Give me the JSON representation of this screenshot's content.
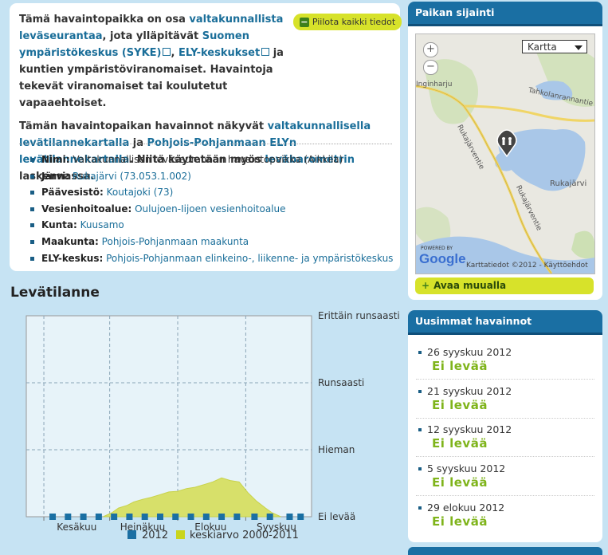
{
  "info": {
    "hide_all_label": "Piilota kaikki tiedot",
    "p1": {
      "t1": "Tämä havaintopaikka on osa ",
      "l1": "valtakunnallista leväseurantaa",
      "t2": ", jota ylläpitävät ",
      "l2": "Suomen ympäristökeskus (SYKE)",
      "t3": ", ",
      "l3": "ELY-keskukset",
      "t4": " ja kuntien ympäristöviranomaiset. Havaintoja tekevät viranomaiset tai koulutetut vapaaehtoiset."
    },
    "p2": {
      "t1": "Tämän havaintopaikan havainnot näkyvät ",
      "l1": "valtakunnallisella levätilannekartalla",
      "t2": " ja ",
      "l2": "Pohjois-Pohjanmaan ELYn levätilannekartalla",
      "t3": ". Niitä käytetään myös ",
      "l3": "leväbarometrin",
      "t4": " laskennassa."
    },
    "attributes": [
      {
        "label": "Nimi:",
        "value": "Valtakunnallisen leväseurannan havaintopaikka (Aikkila)",
        "link": false
      },
      {
        "label": "Järvi:",
        "value": "Rukajärvi (73.053.1.002)",
        "link": true
      },
      {
        "label": "Päävesistö:",
        "value": "Koutajoki (73)",
        "link": true
      },
      {
        "label": "Vesienhoitoalue:",
        "value": "Oulujoen-Iijoen vesienhoitoalue",
        "link": true
      },
      {
        "label": "Kunta:",
        "value": "Kuusamo",
        "link": true
      },
      {
        "label": "Maakunta:",
        "value": "Pohjois-Pohjanmaan maakunta",
        "link": true
      },
      {
        "label": "ELY-keskus:",
        "value": "Pohjois-Pohjanmaan elinkeino-, liikenne- ja ympäristökeskus",
        "link": true
      }
    ]
  },
  "chart_title": "Levätilanne",
  "chart_data": {
    "type": "area",
    "y_categories": [
      "Ei levää",
      "Hieman",
      "Runsaasti",
      "Erittäin runsaasti"
    ],
    "ylim": [
      0,
      3
    ],
    "x_tick_labels": [
      "Kesäkuu",
      "Heinäkuu",
      "Elokuu",
      "Syyskuu"
    ],
    "grid": true,
    "legend_position": "bottom",
    "series": [
      {
        "name": "2012",
        "kind": "markers",
        "color": "#1a6fa3",
        "x": [
          "2012-06-05",
          "2012-06-12",
          "2012-06-19",
          "2012-06-26",
          "2012-07-03",
          "2012-07-10",
          "2012-07-17",
          "2012-07-24",
          "2012-07-31",
          "2012-08-07",
          "2012-08-14",
          "2012-08-21",
          "2012-08-28",
          "2012-09-05",
          "2012-09-12",
          "2012-09-21",
          "2012-09-26"
        ],
        "values": [
          0,
          0,
          0,
          0,
          0,
          0,
          0,
          0,
          0,
          0,
          0,
          0,
          0,
          0,
          0,
          0,
          0
        ]
      },
      {
        "name": "keskiarvo 2000-2011",
        "kind": "area",
        "color": "#d7e06a",
        "x": [
          "2012-06-28",
          "2012-07-02",
          "2012-07-05",
          "2012-07-09",
          "2012-07-12",
          "2012-07-16",
          "2012-07-20",
          "2012-07-24",
          "2012-07-28",
          "2012-08-01",
          "2012-08-05",
          "2012-08-09",
          "2012-08-13",
          "2012-08-17",
          "2012-08-21",
          "2012-08-25",
          "2012-08-29",
          "2012-09-02",
          "2012-09-06",
          "2012-09-10",
          "2012-09-13",
          "2012-09-17"
        ],
        "values": [
          0,
          0.06,
          0.13,
          0.17,
          0.22,
          0.26,
          0.29,
          0.33,
          0.37,
          0.38,
          0.42,
          0.44,
          0.48,
          0.52,
          0.58,
          0.54,
          0.52,
          0.36,
          0.23,
          0.13,
          0.06,
          0
        ]
      }
    ]
  },
  "map": {
    "title": "Paikan sijainti",
    "zoom_in": "+",
    "zoom_out": "−",
    "type_select": "Kartta",
    "labels": [
      "Inginharju",
      "Tahkolanrannantie",
      "Rukajärventie",
      "Rukajärvi",
      "Rukajärventie"
    ],
    "attribution": "Karttatiedot ©2012 - Käyttöehdot",
    "google": "Google",
    "powered": "POWERED BY",
    "open_label": "Avaa muualla"
  },
  "observations": {
    "title": "Uusimmat havainnot",
    "items": [
      {
        "date": "26 syyskuu 2012",
        "status": "Ei levää"
      },
      {
        "date": "21 syyskuu 2012",
        "status": "Ei levää"
      },
      {
        "date": "12 syyskuu 2012",
        "status": "Ei levää"
      },
      {
        "date": "5 syyskuu 2012",
        "status": "Ei levää"
      },
      {
        "date": "29 elokuu 2012",
        "status": "Ei levää"
      }
    ]
  },
  "colors": {
    "accent": "#1a6fa3",
    "highlight": "#d7e22a",
    "link": "#1a6e99",
    "status_ok": "#7fb41b"
  }
}
